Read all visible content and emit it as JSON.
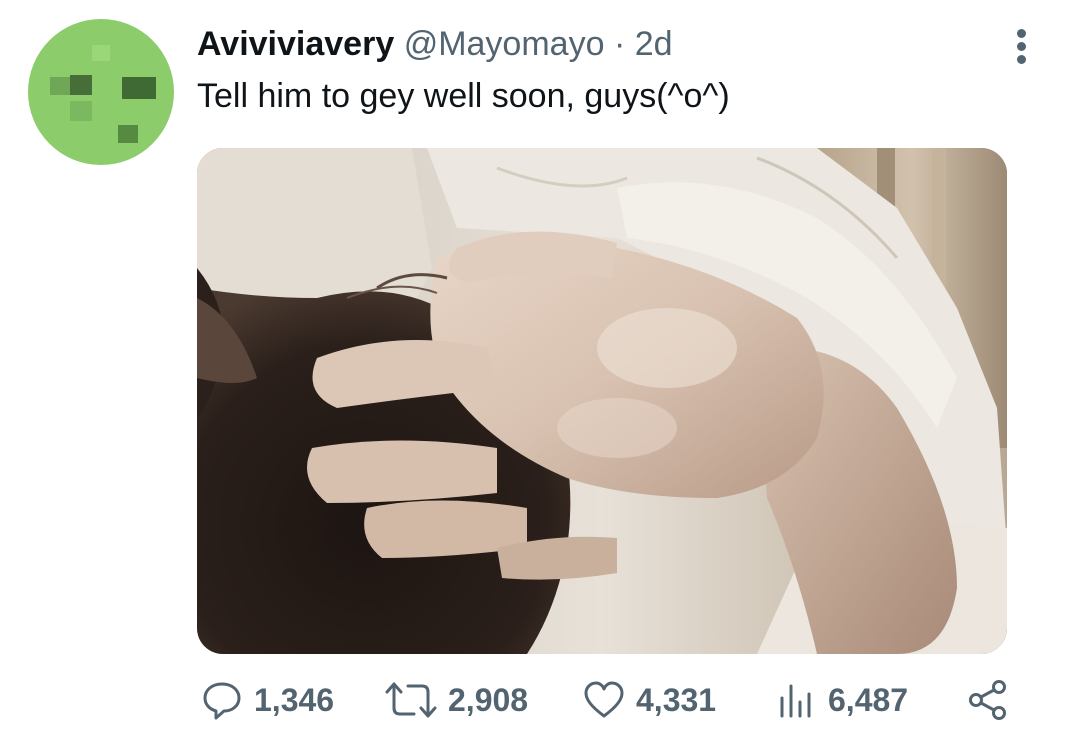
{
  "tweet": {
    "display_name": "Aviviviavery",
    "handle": "@Mayomayo",
    "separator": "·",
    "time": "2d",
    "text": "Tell him to gey well soon, guys(^o^)",
    "avatar_icon": "pixel-identicon-avatar",
    "media_description": "photo"
  },
  "actions": {
    "reply_count": "1,346",
    "retweet_count": "2,908",
    "like_count": "4,331",
    "views_count": "6,487"
  },
  "icons": {
    "more": "more-vertical-icon",
    "reply": "reply-icon",
    "retweet": "retweet-icon",
    "like": "heart-icon",
    "views": "views-bar-icon",
    "share": "share-icon"
  },
  "colors": {
    "text": "#0f1419",
    "secondary": "#536471",
    "avatar_green": "#8ccc6a"
  }
}
